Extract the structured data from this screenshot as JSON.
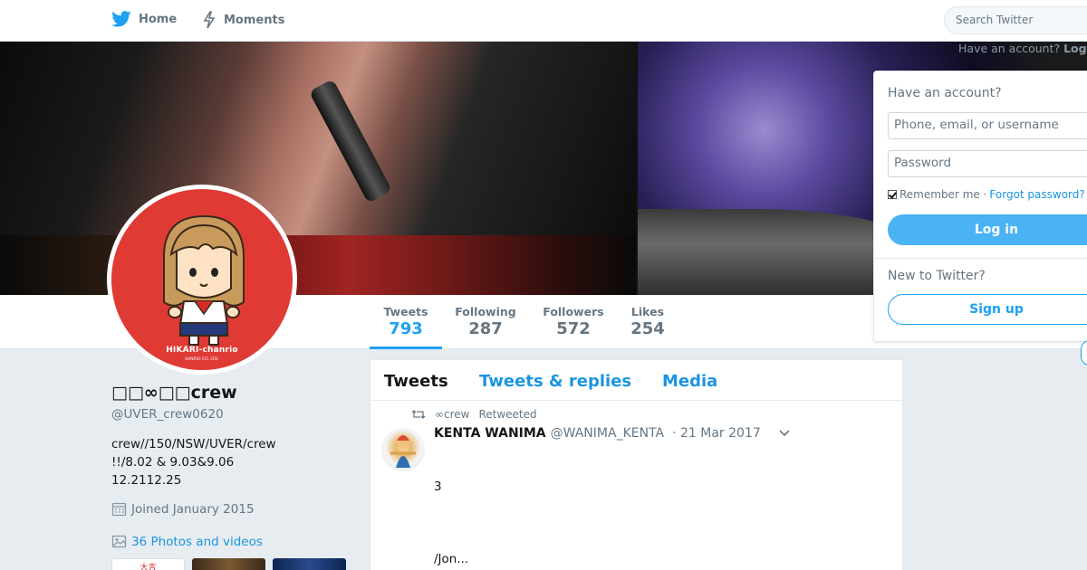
{
  "nav": {
    "home_label": "Home",
    "moments_label": "Moments",
    "search_placeholder": "Search Twitter",
    "have_account_prompt": "Have an account?",
    "login_link": "Log"
  },
  "profile": {
    "display_name": "□□∞□□crew",
    "handle": "@UVER_crew0620",
    "bio_lines": [
      "crew//150/NSW/UVER/crew",
      "!!/8.02 & 9.03&9.06",
      "12.2112.25"
    ],
    "joined": "Joined January 2015",
    "photos_link": "36 Photos and videos",
    "avatar_caption": "HIKARI-chanrio",
    "avatar_subcaption": "SANRIO CO. LTD.",
    "thumb_1_text": "大吉"
  },
  "stats": {
    "tweets": {
      "label": "Tweets",
      "value": "793"
    },
    "following": {
      "label": "Following",
      "value": "287"
    },
    "followers": {
      "label": "Followers",
      "value": "572"
    },
    "likes": {
      "label": "Likes",
      "value": "254"
    }
  },
  "timeline": {
    "tabs": [
      "Tweets",
      "Tweets & replies",
      "Media"
    ],
    "tweet": {
      "retweeted_by": "∞crew",
      "retweeted_label": "Retweeted",
      "author_name": "KENTA WANIMA",
      "author_handle": "@WANIMA_KENTA",
      "timestamp": "· 21 Mar 2017",
      "line1": "3",
      "line2": "/Jon..."
    }
  },
  "login": {
    "title": "Have an account?",
    "username_placeholder": "Phone, email, or username",
    "password_placeholder": "Password",
    "remember_me": "Remember me ·",
    "forgot_password": "Forgot password?",
    "login_button": "Log in",
    "new_to_twitter": "New to Twitter?",
    "signup_button": "Sign up"
  },
  "colors": {
    "brand_blue": "#1da1f2",
    "link_blue": "#1b95e0",
    "background": "#e6ecf0",
    "avatar_red": "#e03a35"
  },
  "icons": [
    "twitter-bird-icon",
    "lightning-icon",
    "retweet-icon",
    "calendar-icon",
    "image-icon",
    "chevron-down-icon"
  ]
}
